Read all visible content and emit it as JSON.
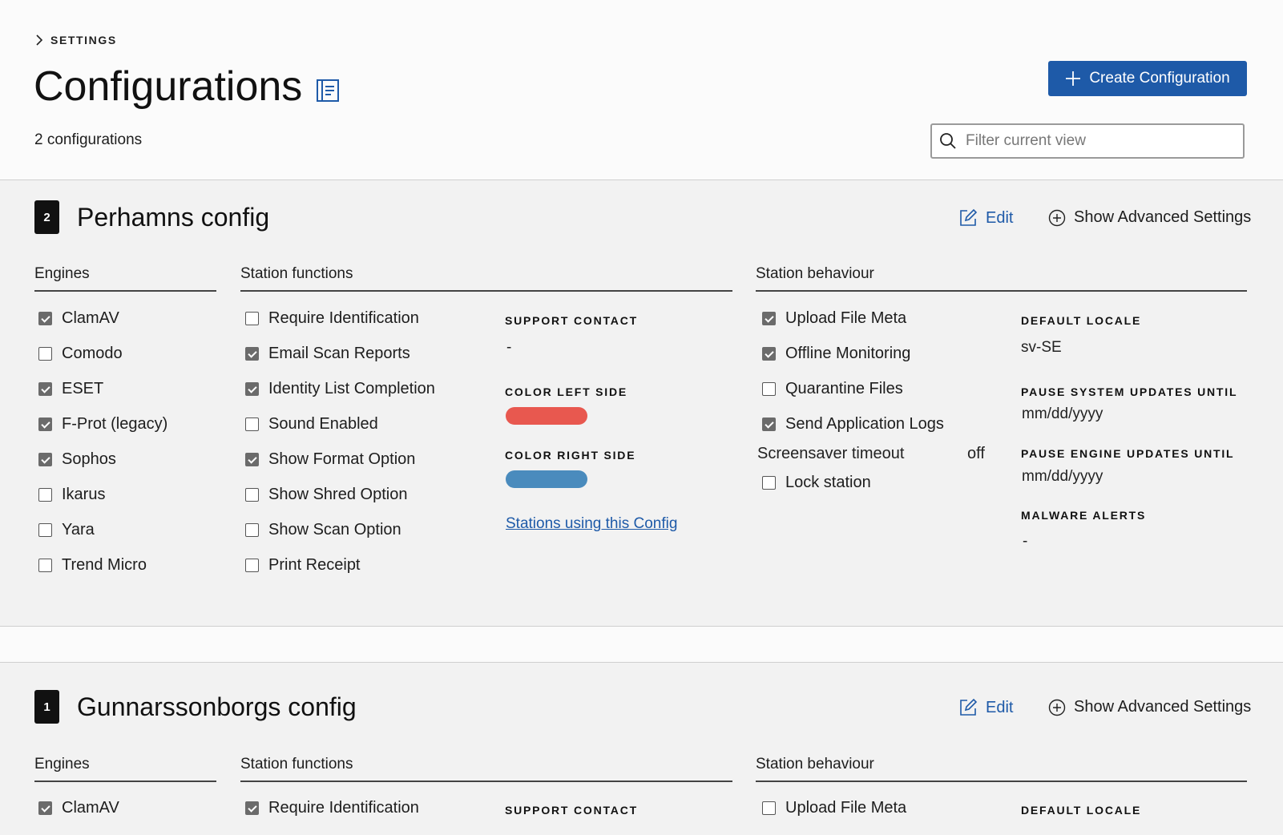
{
  "header": {
    "breadcrumb": "SETTINGS",
    "title": "Configurations",
    "count": "2 configurations",
    "create_label": "Create Configuration",
    "filter_placeholder": "Filter current view"
  },
  "common": {
    "edit_label": "Edit",
    "advanced_label": "Show Advanced Settings",
    "engines_heading": "Engines",
    "functions_heading": "Station functions",
    "behaviour_heading": "Station behaviour"
  },
  "configs": [
    {
      "number": "2",
      "name": "Perhamns config",
      "engines": [
        {
          "label": "ClamAV",
          "checked": true
        },
        {
          "label": "Comodo",
          "checked": false
        },
        {
          "label": "ESET",
          "checked": true
        },
        {
          "label": "F-Prot (legacy)",
          "checked": true
        },
        {
          "label": "Sophos",
          "checked": true
        },
        {
          "label": "Ikarus",
          "checked": false
        },
        {
          "label": "Yara",
          "checked": false
        },
        {
          "label": "Trend Micro",
          "checked": false
        }
      ],
      "functions": [
        {
          "label": "Require Identification",
          "checked": false
        },
        {
          "label": "Email Scan Reports",
          "checked": true
        },
        {
          "label": "Identity List Completion",
          "checked": true
        },
        {
          "label": "Sound Enabled",
          "checked": false
        },
        {
          "label": "Show Format Option",
          "checked": true
        },
        {
          "label": "Show Shred Option",
          "checked": false
        },
        {
          "label": "Show Scan Option",
          "checked": false
        },
        {
          "label": "Print Receipt",
          "checked": false
        }
      ],
      "support_contact_label": "SUPPORT CONTACT",
      "support_contact_value": "-",
      "color_left_label": "COLOR LEFT SIDE",
      "color_left": "#e8584f",
      "color_right_label": "COLOR RIGHT SIDE",
      "color_right": "#4a8bbd",
      "stations_link": "Stations using this Config",
      "behaviour": [
        {
          "label": "Upload File Meta",
          "checked": true
        },
        {
          "label": "Offline Monitoring",
          "checked": true
        },
        {
          "label": "Quarantine Files",
          "checked": false
        },
        {
          "label": "Send Application Logs",
          "checked": true
        }
      ],
      "screensaver_label": "Screensaver timeout",
      "screensaver_value": "off",
      "lock_station": {
        "label": "Lock station",
        "checked": false
      },
      "default_locale_label": "DEFAULT LOCALE",
      "default_locale_value": "sv-SE",
      "pause_system_label": "PAUSE SYSTEM UPDATES UNTIL",
      "pause_system_value": "mm/dd/yyyy",
      "pause_engine_label": "PAUSE ENGINE UPDATES UNTIL",
      "pause_engine_value": "mm/dd/yyyy",
      "malware_label": "MALWARE ALERTS",
      "malware_value": "-"
    },
    {
      "number": "1",
      "name": "Gunnarssonborgs config",
      "engines": [
        {
          "label": "ClamAV",
          "checked": true
        }
      ],
      "functions": [
        {
          "label": "Require Identification",
          "checked": true
        }
      ],
      "support_contact_label": "SUPPORT CONTACT",
      "behaviour": [
        {
          "label": "Upload File Meta",
          "checked": false
        }
      ],
      "default_locale_label": "DEFAULT LOCALE"
    }
  ]
}
